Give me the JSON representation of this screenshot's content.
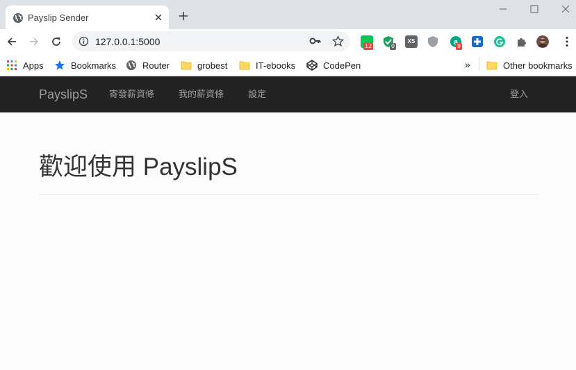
{
  "browser": {
    "tab": {
      "title": "Payslip Sender"
    },
    "address": {
      "url": "127.0.0.1:5000"
    },
    "extensions": [
      {
        "icon": "line-icon",
        "badge": "12",
        "color": "#06c755",
        "badge_color": "#e8453c"
      },
      {
        "icon": "shield-check-icon",
        "badge": "0",
        "color": "#1aa260",
        "badge_color": "#5f6368"
      },
      {
        "icon": "xs-icon",
        "label": "XS",
        "color": "#5f6368"
      },
      {
        "icon": "shield-icon",
        "color": "#9aa0a6"
      },
      {
        "icon": "a-icon",
        "badge": "9",
        "color": "#00a884",
        "badge_color": "#e8453c"
      },
      {
        "icon": "plus-square-icon",
        "color": "#1967d2"
      },
      {
        "icon": "grammarly-icon",
        "color": "#15c39a"
      },
      {
        "icon": "puzzle-icon",
        "color": "#5f6368"
      }
    ],
    "bookmarks": [
      {
        "label": "Apps",
        "icon": "apps-grid-icon"
      },
      {
        "label": "Bookmarks",
        "icon": "star-icon"
      },
      {
        "label": "Router",
        "icon": "globe-icon"
      },
      {
        "label": "grobest",
        "icon": "folder-icon"
      },
      {
        "label": "IT-ebooks",
        "icon": "folder-icon"
      },
      {
        "label": "CodePen",
        "icon": "codepen-icon"
      }
    ],
    "more_bookmarks": "»",
    "other_bookmarks": "Other bookmarks"
  },
  "app": {
    "brand": "PayslipS",
    "nav": [
      {
        "label": "寄發薪資條"
      },
      {
        "label": "我的薪資條"
      },
      {
        "label": "設定"
      }
    ],
    "login": "登入",
    "page_title": "歡迎使用 PayslipS"
  },
  "colors": {
    "navbar_bg": "#222222",
    "nav_text": "#9d9d9d",
    "heading": "#333333",
    "tabstrip": "#dee1e6"
  }
}
